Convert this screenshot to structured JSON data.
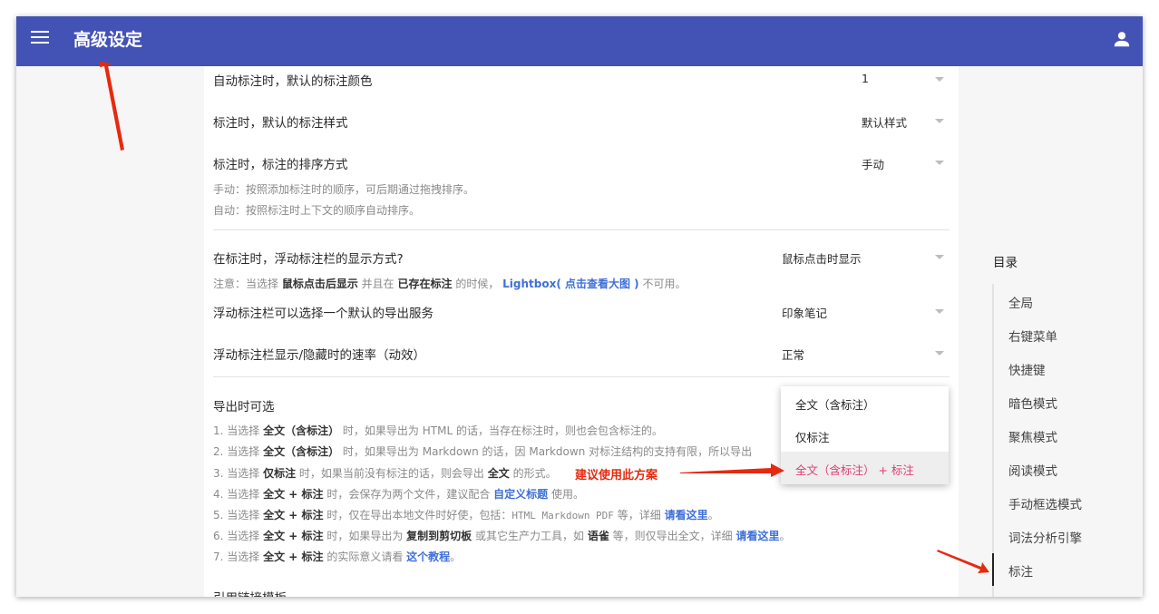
{
  "appbar": {
    "title": "高级设定"
  },
  "settings": {
    "auto_color_label": "自动标注时，默认的标注颜色",
    "auto_color_value": "1",
    "style_label": "标注时，默认的标注样式",
    "style_value": "默认样式",
    "sort_label": "标注时，标注的排序方式",
    "sort_value": "手动",
    "sort_note_1": "手动：按照添加标注时的顺序，可后期通过拖拽排序。",
    "sort_note_2": "自动：按照标注时上下文的顺序自动排序。",
    "float_display_label": "在标注时，浮动标注栏的显示方式?",
    "float_display_value": "鼠标点击时显示",
    "float_note": {
      "p1": "注意：当选择 ",
      "b1": "鼠标点击后显示",
      "p2": " 并且在 ",
      "b2": "已存在标注",
      "p3": " 的时候， ",
      "link": "Lightbox( 点击查看大图 )",
      "p4": " 不可用。"
    },
    "export_service_label": "浮动标注栏可以选择一个默认的导出服务",
    "export_service_value": "印象笔记",
    "speed_label": "浮动标注栏显示/隐藏时的速率（动效）",
    "speed_value": "正常",
    "export_label": "导出时可选",
    "export_notes": [
      {
        "p1": "1. 当选择 ",
        "b1": "全文（含标注）",
        "p2": " 时，如果导出为 HTML 的话，当存在标注时，则也会包含标注的。"
      },
      {
        "p1": "2. 当选择 ",
        "b1": "全文（含标注）",
        "p2": " 时，如果导出为 Markdown 的话，因 Markdown 对标注结构的支持有限，所以导出"
      },
      {
        "p1": "3. 当选择 ",
        "b1": "仅标注",
        "p2": " 时，如果当前没有标注的话，则会导出 ",
        "b2": "全文",
        "p3": " 的形式。"
      },
      {
        "p1": "4. 当选择 ",
        "b1": "全文 + 标注",
        "p2": " 时，会保存为两个文件，建议配合 ",
        "link": "自定义标题",
        "p3": " 使用。"
      },
      {
        "p1": "5. 当选择 ",
        "b1": "全文 + 标注",
        "p2": " 时，仅在导出本地文件时好使，包括：",
        "mono": "HTML Markdown PDF",
        "p3": " 等，详细 ",
        "link": "请看这里",
        "p4": "。"
      },
      {
        "p1": "6. 当选择 ",
        "b1": "全文 + 标注",
        "p2": " 时，如果导出为 ",
        "b2": "复制到剪切板",
        "p3": " 或其它生产力工具，如 ",
        "b3": "语雀",
        "p4": " 等，则仅导出全文，详细 ",
        "link": "请看这里",
        "p5": "。"
      },
      {
        "p1": "7. 当选择 ",
        "b1": "全文 + 标注",
        "p2": " 的实际意义请看 ",
        "link": "这个教程",
        "p3": "。"
      }
    ],
    "next_section_label": "引用链接模板"
  },
  "dropdown": {
    "options": [
      "全文（含标注）",
      "仅标注",
      "全文（含标注） + 标注"
    ],
    "selected": "全文（含标注） + 标注"
  },
  "annotation": {
    "text": "建议使用此方案"
  },
  "toc": {
    "title": "目录",
    "items": [
      "全局",
      "右键菜单",
      "快捷键",
      "暗色模式",
      "聚焦模式",
      "阅读模式",
      "手动框选模式",
      "词法分析引擎",
      "标注"
    ],
    "active": "标注"
  },
  "colors": {
    "appbar": "#4352b5",
    "link": "#3f6fd8",
    "selected_option": "#e03b75",
    "annotation": "#e52a10"
  },
  "icons": [
    "menu-icon",
    "account-icon",
    "dropdown-caret-icon",
    "annotation-arrow-icon"
  ]
}
